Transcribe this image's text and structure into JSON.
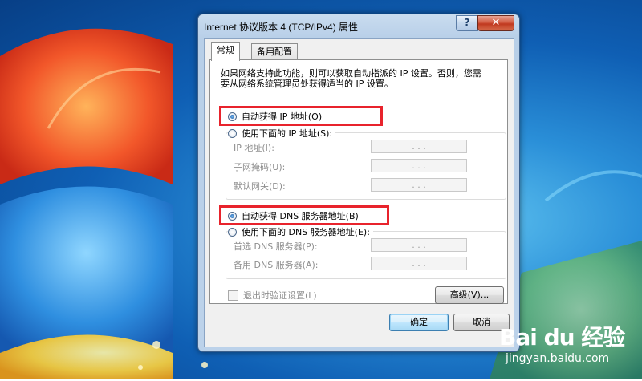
{
  "window": {
    "title": "Internet 协议版本 4 (TCP/IPv4) 属性",
    "help_label": "?",
    "close_label": "✕"
  },
  "tabs": [
    {
      "label": "常规",
      "active": true
    },
    {
      "label": "备用配置",
      "active": false
    }
  ],
  "general": {
    "description": "如果网络支持此功能，则可以获取自动指派的 IP 设置。否则，您需要从网络系统管理员处获得适当的 IP 设置。",
    "ip": {
      "auto_label": "自动获得 IP 地址(O)",
      "auto_selected": true,
      "manual_label": "使用下面的 IP 地址(S):",
      "fields": [
        {
          "label": "IP 地址(I):",
          "value": ". . ."
        },
        {
          "label": "子网掩码(U):",
          "value": ". . ."
        },
        {
          "label": "默认网关(D):",
          "value": ". . ."
        }
      ]
    },
    "dns": {
      "auto_label": "自动获得 DNS 服务器地址(B)",
      "auto_selected": true,
      "manual_label": "使用下面的 DNS 服务器地址(E):",
      "fields": [
        {
          "label": "首选 DNS 服务器(P):",
          "value": ". . ."
        },
        {
          "label": "备用 DNS 服务器(A):",
          "value": ". . ."
        }
      ]
    },
    "validate_label": "退出时验证设置(L)",
    "advanced_label": "高级(V)..."
  },
  "buttons": {
    "ok": "确定",
    "cancel": "取消"
  },
  "watermark": {
    "brand": "Bai du 经验",
    "url": "jingyan.baidu.com"
  },
  "colors": {
    "highlight": "#e8232c",
    "desktop": "#1a6fc4"
  }
}
